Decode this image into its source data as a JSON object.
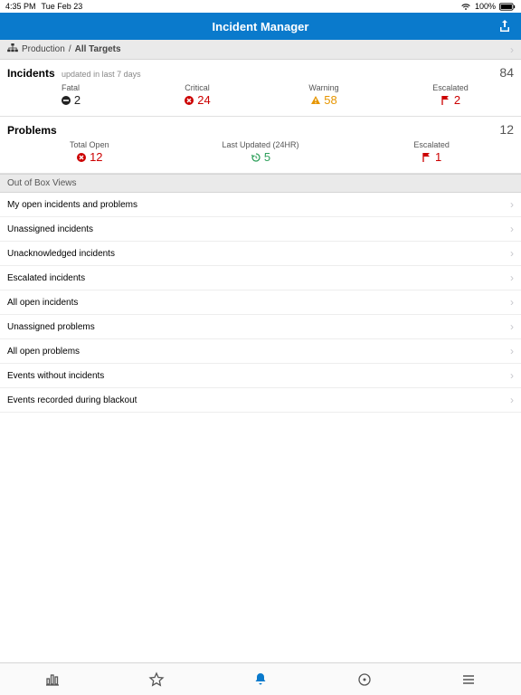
{
  "status": {
    "time": "4:35 PM",
    "date": "Tue Feb 23",
    "battery": "100%"
  },
  "nav": {
    "title": "Incident Manager"
  },
  "breadcrumb": {
    "parent": "Production",
    "sep": "/",
    "current": "All Targets"
  },
  "incidents": {
    "title": "Incidents",
    "subtitle": "updated in last 7 days",
    "total": "84",
    "stats": [
      {
        "label": "Fatal",
        "value": "2"
      },
      {
        "label": "Critical",
        "value": "24"
      },
      {
        "label": "Warning",
        "value": "58"
      },
      {
        "label": "Escalated",
        "value": "2"
      }
    ]
  },
  "problems": {
    "title": "Problems",
    "total": "12",
    "stats": [
      {
        "label": "Total Open",
        "value": "12"
      },
      {
        "label": "Last Updated (24HR)",
        "value": "5"
      },
      {
        "label": "Escalated",
        "value": "1"
      }
    ]
  },
  "views": {
    "header": "Out of Box Views",
    "items": [
      "My open incidents and problems",
      "Unassigned incidents",
      "Unacknowledged incidents",
      "Escalated incidents",
      "All open incidents",
      "Unassigned problems",
      "All open problems",
      "Events without incidents",
      "Events recorded during blackout"
    ]
  }
}
